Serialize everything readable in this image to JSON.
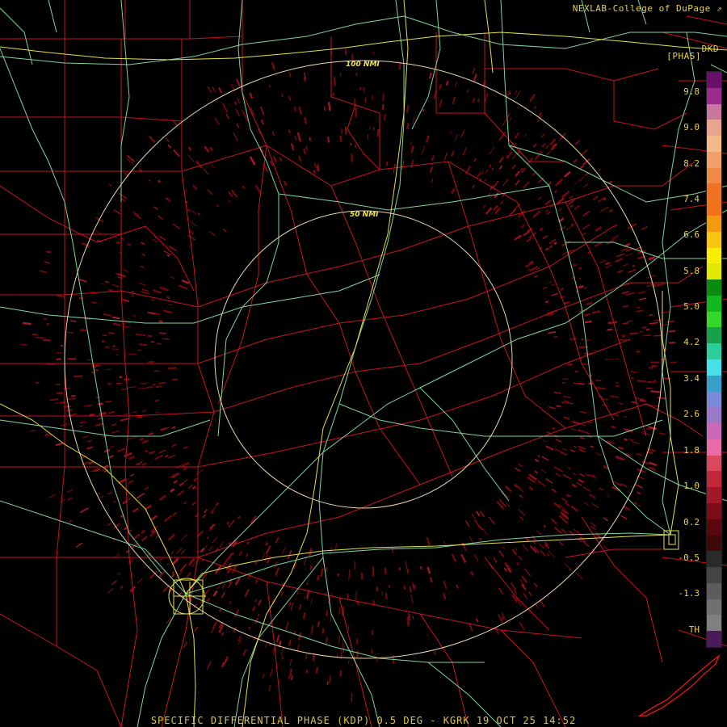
{
  "header": {
    "credit": "NEXLAB-College of DuPage",
    "site": "DKD",
    "product_tag": "[PHAS]"
  },
  "footer": {
    "caption": "SPECIFIC DIFFERENTIAL PHASE (KDP) 0.5 DEG - KGRK 19 OCT 25 14:52"
  },
  "range_rings": [
    {
      "label": "100 NMI"
    },
    {
      "label": "50 NMI"
    }
  ],
  "colorbar": {
    "ticks": [
      "9.8",
      "9.0",
      "8.2",
      "7.4",
      "6.6",
      "5.8",
      "5.0",
      "4.2",
      "3.4",
      "2.6",
      "1.8",
      "1.0",
      "0.2",
      "-0.5",
      "-1.3",
      "TH"
    ],
    "colors": [
      "#6a0f6a",
      "#9c2a8c",
      "#c7779e",
      "#e8a48c",
      "#f4b98a",
      "#f2a06a",
      "#f08a4a",
      "#ee7424",
      "#f07418",
      "#f29b10",
      "#f8c810",
      "#f6f000",
      "#e4e800",
      "#0a8a10",
      "#12b81c",
      "#36d62a",
      "#18a04a",
      "#2ccc9c",
      "#48e0e8",
      "#38a0c8",
      "#7a8ad8",
      "#9a78c8",
      "#c86ab8",
      "#e86aa8",
      "#d8485e",
      "#c2283c",
      "#a0182a",
      "#7c0c18",
      "#5a0810",
      "#3c0808",
      "#2a2a2a",
      "#444444",
      "#5c5c5c",
      "#707070",
      "#808080",
      "#4a1a5a"
    ]
  },
  "colors": {
    "county_lines": "#c8141e",
    "highways": "#7ed4a0",
    "interstates": "#e4e04a",
    "range_rings": "#e8d8a8",
    "echo": "#7a0c10",
    "coastline": "#e01414"
  }
}
